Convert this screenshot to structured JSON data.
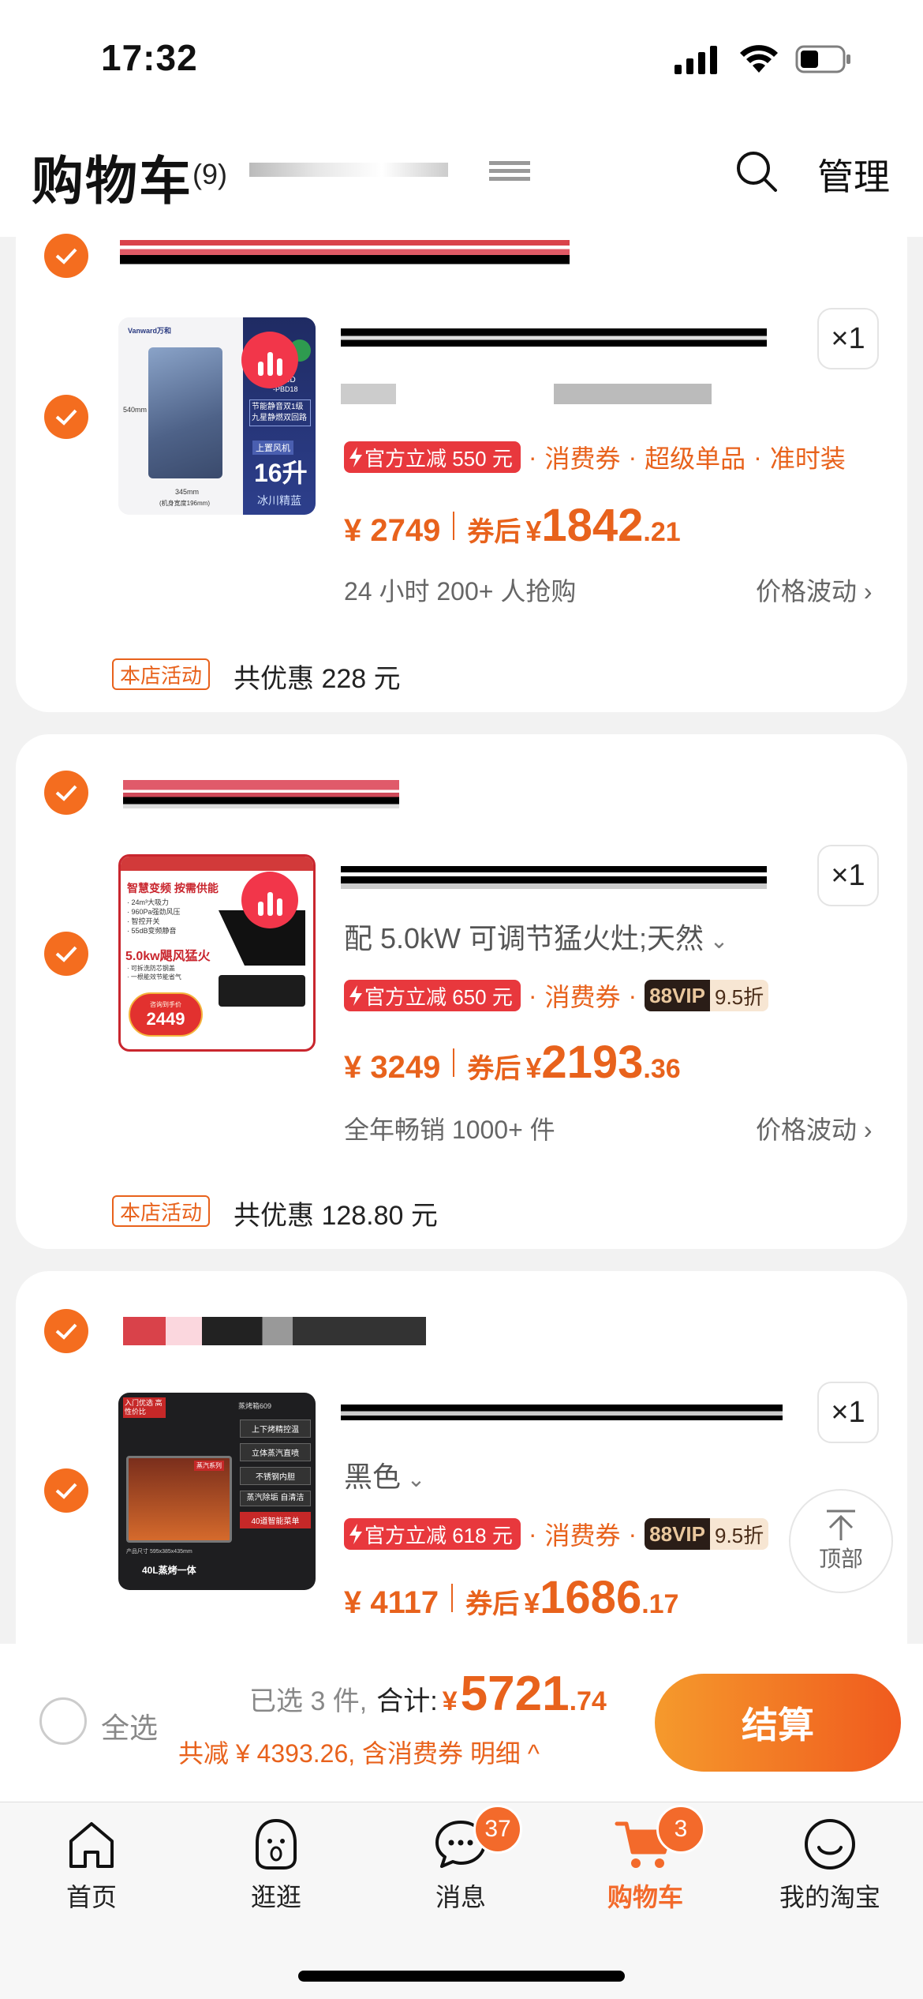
{
  "status_bar": {
    "time": "17:32"
  },
  "header": {
    "title": "购物车",
    "count": "(9)",
    "manage_label": "管理"
  },
  "items": [
    {
      "spec": "",
      "quantity": "×1",
      "official_discount": "官方立减 550 元",
      "tags": [
        "消费券",
        "超级单品",
        "准时装"
      ],
      "price": "¥ 2749",
      "after_coupon_label": "券后",
      "coupon_yen": "¥",
      "coupon_int": "1842",
      "coupon_dec": ".21",
      "sales": "24 小时 200+ 人抢购",
      "fluctuation": "价格波动",
      "shop_tag": "本店活动",
      "shop_total": "共优惠 228 元",
      "thumb": {
        "brand": "Vanward万和",
        "capacity": "16升",
        "color": "冰川精蓝",
        "wind": "上置风机",
        "feature": "节能静音双1级 九星静燃双回路",
        "dim_h": "540mm",
        "dim_w": "345mm",
        "dim_d": "(机身宽度196mm)",
        "model": "9D",
        "model2": "-PBD18"
      }
    },
    {
      "spec": "配 5.0kW 可调节猛火灶;天然",
      "quantity": "×1",
      "official_discount": "官方立减 650 元",
      "tags": [
        "消费券"
      ],
      "vip_label": "88VIP",
      "vip_discount": "9.5折",
      "price": "¥ 3249",
      "after_coupon_label": "券后",
      "coupon_yen": "¥",
      "coupon_int": "2193",
      "coupon_dec": ".36",
      "sales": "全年畅销 1000+ 件",
      "fluctuation": "价格波动",
      "shop_tag": "本店活动",
      "shop_total": "共优惠 128.80 元",
      "thumb": {
        "headline": "智慧变频 按需供能",
        "bullets": [
          "· 24m³大吸力",
          "· 960Pa强劲风压",
          "· 智控开关",
          "· 55dB变频静音"
        ],
        "fire": "5.0kw飓风猛火",
        "bullets2": [
          "· 可拆洗防芯钢盖",
          "· 一根能效节能省气"
        ],
        "price_label": "咨询到手价",
        "price": "2449"
      }
    },
    {
      "spec": "黑色",
      "quantity": "×1",
      "official_discount": "官方立减 618 元",
      "tags": [
        "消费券"
      ],
      "vip_label": "88VIP",
      "vip_discount": "9.5折",
      "price": "¥ 4117",
      "after_coupon_label": "券后",
      "coupon_yen": "¥",
      "coupon_int": "1686",
      "coupon_dec": ".17",
      "thumb": {
        "corner": "入门优选 高性价比",
        "model": "蒸烤箱609",
        "features": [
          "上下烤精控温",
          "立体蒸汽直喷",
          "不锈钢内胆",
          "蒸汽除垢 自清洁",
          "40道智能菜单"
        ],
        "size": "产品尺寸 595x385x435mm",
        "bottom": "40L蒸烤一体",
        "ribbon": "蒸汽系列"
      }
    }
  ],
  "back_to_top": "顶部",
  "checkout": {
    "select_all": "全选",
    "selected": "已选 3 件,",
    "total_label": "合计:",
    "total_yen": "¥",
    "total_int": "5721",
    "total_dec": ".74",
    "discount": "共减 ¥ 4393.26, 含消费券 明细",
    "button": "结算"
  },
  "tabbar": [
    {
      "label": "首页",
      "icon": "home-icon"
    },
    {
      "label": "逛逛",
      "icon": "browse-icon"
    },
    {
      "label": "消息",
      "icon": "message-icon",
      "badge": "37"
    },
    {
      "label": "购物车",
      "icon": "cart-icon",
      "badge": "3",
      "active": true
    },
    {
      "label": "我的淘宝",
      "icon": "profile-icon"
    }
  ],
  "colors": {
    "accent": "#f46d1f",
    "price": "#e8621c",
    "official": "#e8383d",
    "badge": "#f36a2b"
  }
}
